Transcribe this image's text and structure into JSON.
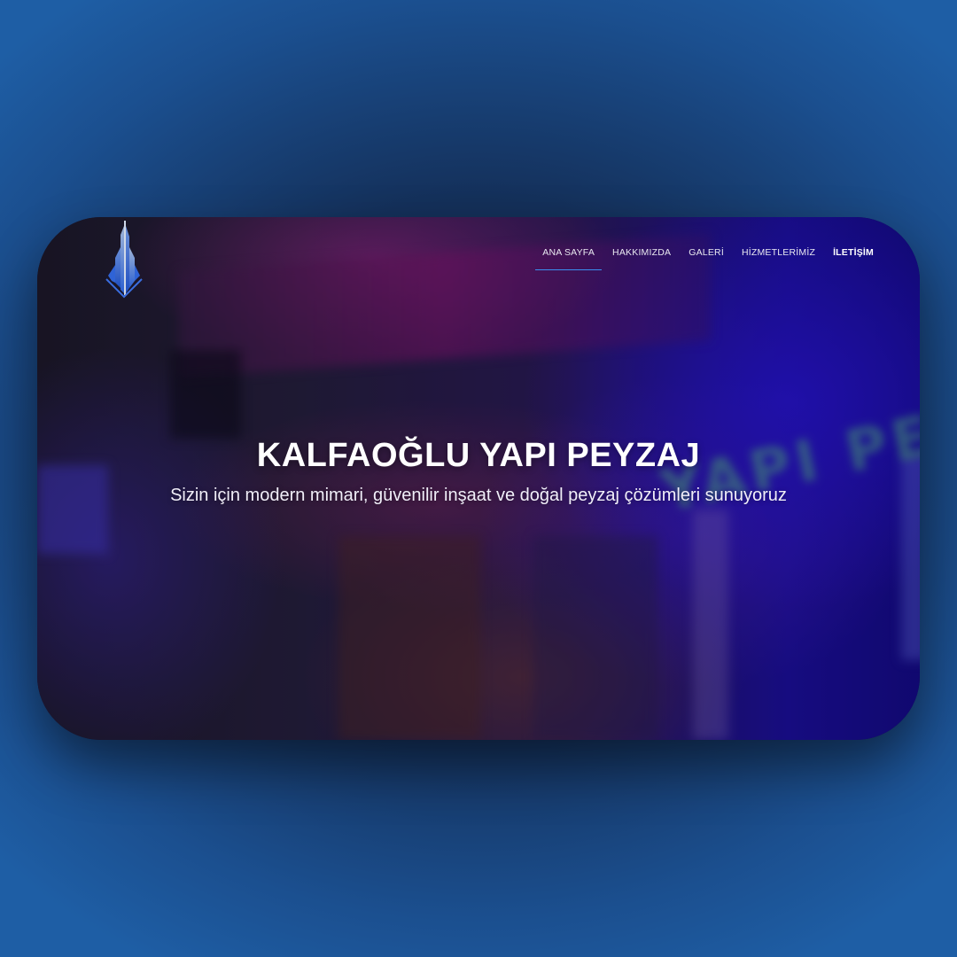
{
  "brand": {
    "logo_icon": "building-tower-logo",
    "accent_color": "#3a8ff0"
  },
  "nav": {
    "items": [
      {
        "label": "ANA SAYFA",
        "active": true
      },
      {
        "label": "HAKKIMIZDA",
        "active": false
      },
      {
        "label": "GALERİ",
        "active": false
      },
      {
        "label": "HİZMETLERİMİZ",
        "active": false
      },
      {
        "label": "İLETİŞİM",
        "active": false,
        "emphasized": true
      }
    ]
  },
  "hero": {
    "title": "KALFAOĞLU YAPI PEYZAJ",
    "subtitle": "Sizin için modern mimari, güvenilir inşaat ve doğal peyzaj çözümleri sunuyoruz",
    "background_sign_text": "YAPI PEYZA"
  }
}
